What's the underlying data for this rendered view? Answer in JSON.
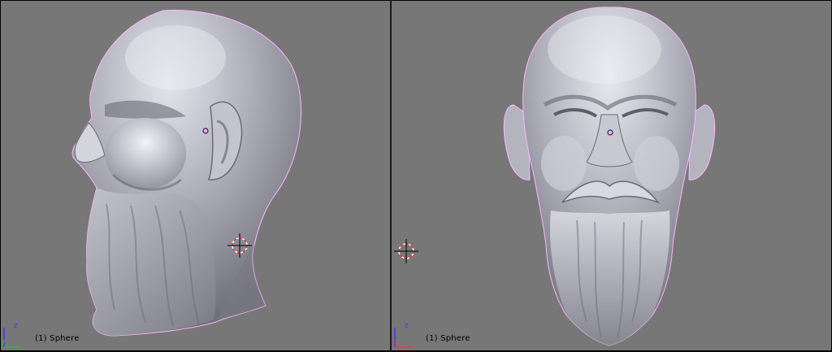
{
  "viewports": [
    {
      "id": "left",
      "view": "side",
      "object_label": "(1) Sphere",
      "axes": {
        "vertical": "z",
        "horizontal": "y"
      },
      "axis_colors": {
        "z": "#3a3aff",
        "y": "#2fbf2f"
      }
    },
    {
      "id": "right",
      "view": "front",
      "object_label": "(1) Sphere",
      "axes": {
        "vertical": "z",
        "horizontal": "x"
      },
      "axis_colors": {
        "z": "#3a3aff",
        "x": "#ff3030"
      }
    }
  ],
  "colors": {
    "viewport_background": "#777777",
    "divider": "#1a1a1a",
    "mesh_base": "#a9a9b3",
    "mesh_highlight": "#e6e6ee",
    "mesh_shadow": "#6d6d78",
    "selection_outline": "#ffb6ff",
    "cursor_ring_red": "#ff2a2a",
    "cursor_ring_white": "#ffffff",
    "cursor_cross": "#000000",
    "object_origin": "#5a0a5a"
  },
  "icons": [
    "3d-cursor-icon",
    "axis-gizmo-icon",
    "object-origin-icon"
  ]
}
